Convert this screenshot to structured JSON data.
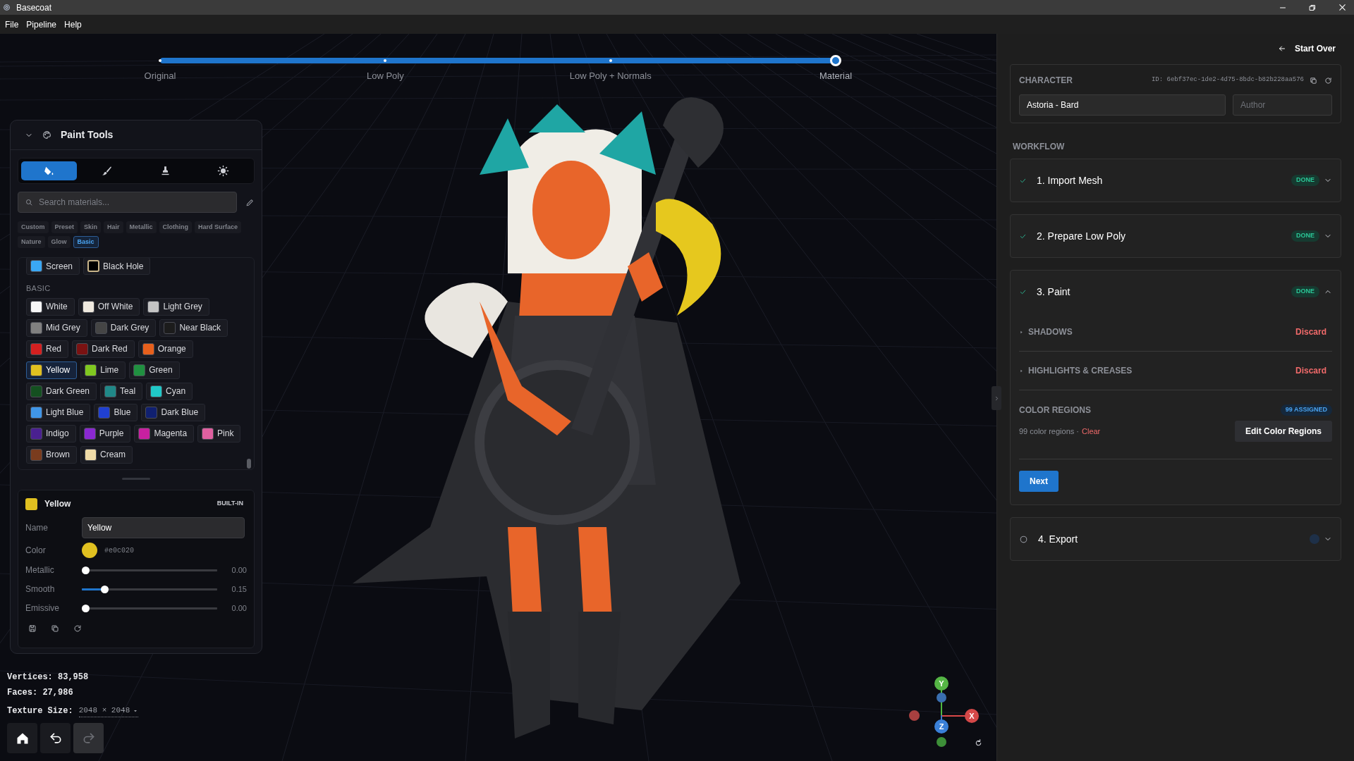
{
  "window": {
    "title": "Basecoat"
  },
  "menu": [
    "File",
    "Pipeline",
    "Help"
  ],
  "pipeline": {
    "stages": [
      {
        "label": "Original",
        "selected": false
      },
      {
        "label": "Low Poly",
        "selected": false
      },
      {
        "label": "Low Poly + Normals",
        "selected": false
      },
      {
        "label": "Material",
        "selected": true
      }
    ]
  },
  "paint_tools": {
    "title": "Paint Tools",
    "expanded": true,
    "tools": [
      {
        "kind": "fill",
        "selected": true
      },
      {
        "kind": "brush",
        "selected": false
      },
      {
        "kind": "stamp",
        "selected": false
      },
      {
        "kind": "light",
        "selected": false
      }
    ],
    "search": {
      "placeholder": "Search materials..."
    },
    "categories": [
      {
        "label": "Custom",
        "selected": false
      },
      {
        "label": "Preset",
        "selected": false
      },
      {
        "label": "Skin",
        "selected": false
      },
      {
        "label": "Hair",
        "selected": false
      },
      {
        "label": "Metallic",
        "selected": false
      },
      {
        "label": "Clothing",
        "selected": false
      },
      {
        "label": "Hard Surface",
        "selected": false
      },
      {
        "label": "Nature",
        "selected": false
      },
      {
        "label": "Glow",
        "selected": false
      },
      {
        "label": "Basic",
        "selected": true
      }
    ],
    "materials_top": [
      {
        "label": "Screen",
        "color": "#3aa8f5",
        "selected": false
      },
      {
        "label": "Black Hole",
        "color": "#000000",
        "selected": false
      }
    ],
    "section": "BASIC",
    "material_rows": [
      [
        {
          "label": "White",
          "color": "#f7f7f7",
          "selected": false
        },
        {
          "label": "Off White",
          "color": "#efe9df",
          "selected": false
        },
        {
          "label": "Light Grey",
          "color": "#c4c4c4",
          "selected": false
        }
      ],
      [
        {
          "label": "Mid Grey",
          "color": "#808080",
          "selected": false
        },
        {
          "label": "Dark Grey",
          "color": "#454545",
          "selected": false
        },
        {
          "label": "Near Black",
          "color": "#1c1c1c",
          "selected": false
        }
      ],
      [
        {
          "label": "Red",
          "color": "#d42020",
          "selected": false
        },
        {
          "label": "Dark Red",
          "color": "#7a1212",
          "selected": false
        },
        {
          "label": "Orange",
          "color": "#e8601c",
          "selected": false
        }
      ],
      [
        {
          "label": "Yellow",
          "color": "#e0c020",
          "selected": true
        },
        {
          "label": "Lime",
          "color": "#80c820",
          "selected": false
        },
        {
          "label": "Green",
          "color": "#209040",
          "selected": false
        }
      ],
      [
        {
          "label": "Dark Green",
          "color": "#145020",
          "selected": false
        },
        {
          "label": "Teal",
          "color": "#208888",
          "selected": false
        },
        {
          "label": "Cyan",
          "color": "#20c8c8",
          "selected": false
        }
      ],
      [
        {
          "label": "Light Blue",
          "color": "#4096e8",
          "selected": false
        },
        {
          "label": "Blue",
          "color": "#2040d0",
          "selected": false
        },
        {
          "label": "Dark Blue",
          "color": "#102070",
          "selected": false
        }
      ],
      [
        {
          "label": "Indigo",
          "color": "#4a2090",
          "selected": false
        },
        {
          "label": "Purple",
          "color": "#8a28d0",
          "selected": false
        },
        {
          "label": "Magenta",
          "color": "#c820a0",
          "selected": false
        },
        {
          "label": "Pink",
          "color": "#e060a0",
          "selected": false
        }
      ],
      [
        {
          "label": "Brown",
          "color": "#7a3c1e",
          "selected": false
        },
        {
          "label": "Cream",
          "color": "#f0dca8",
          "selected": false
        }
      ]
    ],
    "detail": {
      "title": "Yellow",
      "color": "#e0c020",
      "badge": "BUILT-IN",
      "name_label": "Name",
      "name_value": "Yellow",
      "color_label": "Color",
      "hex": "#e0c020",
      "sliders": [
        {
          "label": "Metallic",
          "level": 0,
          "reading": "0.00"
        },
        {
          "label": "Smooth",
          "level": 0.15,
          "reading": "0.15"
        },
        {
          "label": "Emissive",
          "level": 0,
          "reading": "0.00"
        }
      ]
    }
  },
  "stats": {
    "vertices": "Vertices: 83,958",
    "faces": "Faces: 27,986",
    "texture_label": "Texture Size:",
    "texture_value": "2048 × 2048"
  },
  "view_buttons": [
    {
      "kind": "home",
      "disabled": false
    },
    {
      "kind": "undo",
      "disabled": false
    },
    {
      "kind": "redo",
      "disabled": true
    }
  ],
  "gizmo": {
    "axes": [
      {
        "label": "Y",
        "kind": "y"
      },
      {
        "label": "X",
        "kind": "x"
      },
      {
        "label": "Z",
        "kind": "z"
      }
    ]
  },
  "side": {
    "start_over": "Start Over",
    "character": {
      "label": "CHARACTER",
      "id": "ID: 6ebf37ec-1de2-4d75-8bdc-b82b228aa576",
      "name": "Astoria - Bard",
      "author_placeholder": "Author"
    },
    "workflow_label": "WORKFLOW",
    "steps": [
      {
        "title": "1. Import Mesh",
        "done": true,
        "badge": "DONE",
        "expanded": false
      },
      {
        "title": "2. Prepare Low Poly",
        "done": true,
        "badge": "DONE",
        "expanded": false
      },
      {
        "title": "3. Paint",
        "done": true,
        "badge": "DONE",
        "expanded": true
      },
      {
        "title": "4. Export",
        "done": false,
        "expanded": false
      }
    ],
    "paint": {
      "layers": [
        {
          "label": "SHADOWS",
          "action": "Discard"
        },
        {
          "label": "HIGHLIGHTS & CREASES",
          "action": "Discard"
        }
      ],
      "regions_label": "COLOR REGIONS",
      "regions_badge": "99 ASSIGNED",
      "regions_summary": "99 color regions ·",
      "clear": "Clear",
      "edit": "Edit Color Regions",
      "next": "Next"
    }
  }
}
